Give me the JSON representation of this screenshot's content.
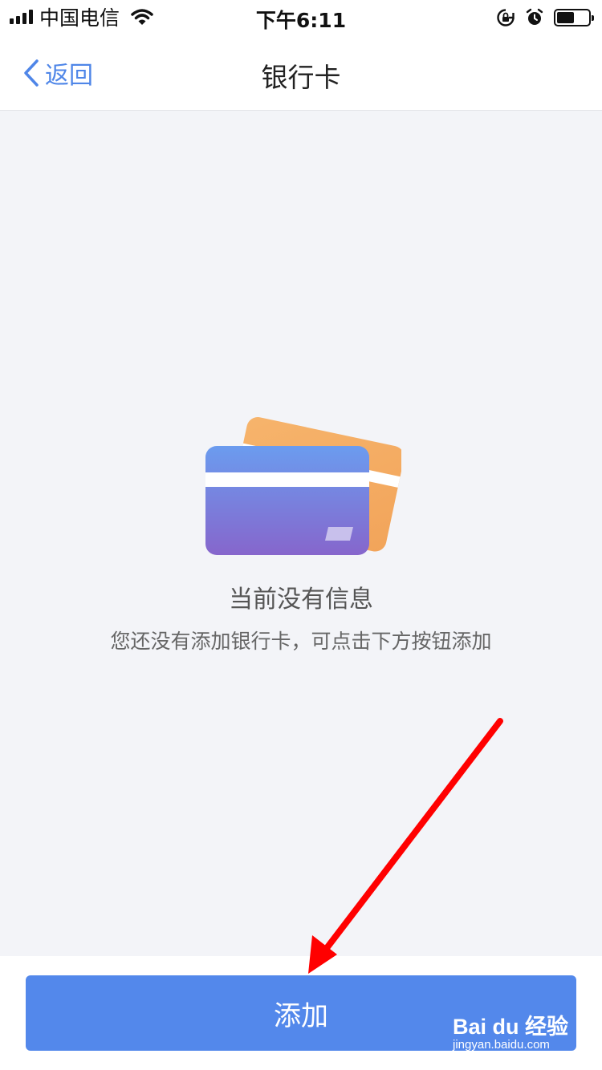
{
  "status_bar": {
    "carrier": "中国电信",
    "time": "下午6:11",
    "icons": [
      "signal-icon",
      "wifi-icon",
      "rotation-lock-icon",
      "alarm-icon",
      "battery-icon"
    ],
    "battery_level": 0.55
  },
  "nav": {
    "back_label": "返回",
    "title": "银行卡"
  },
  "empty_state": {
    "icon": "bank-card-illustration",
    "title": "当前没有信息",
    "description": "您还没有添加银行卡，可点击下方按钮添加"
  },
  "footer": {
    "add_label": "添加"
  },
  "watermark": {
    "brand": "Bai du 经验",
    "url": "jingyan.baidu.com"
  },
  "colors": {
    "accent": "#5388eb",
    "background": "#f3f4f8",
    "annotation": "#ff0000"
  }
}
